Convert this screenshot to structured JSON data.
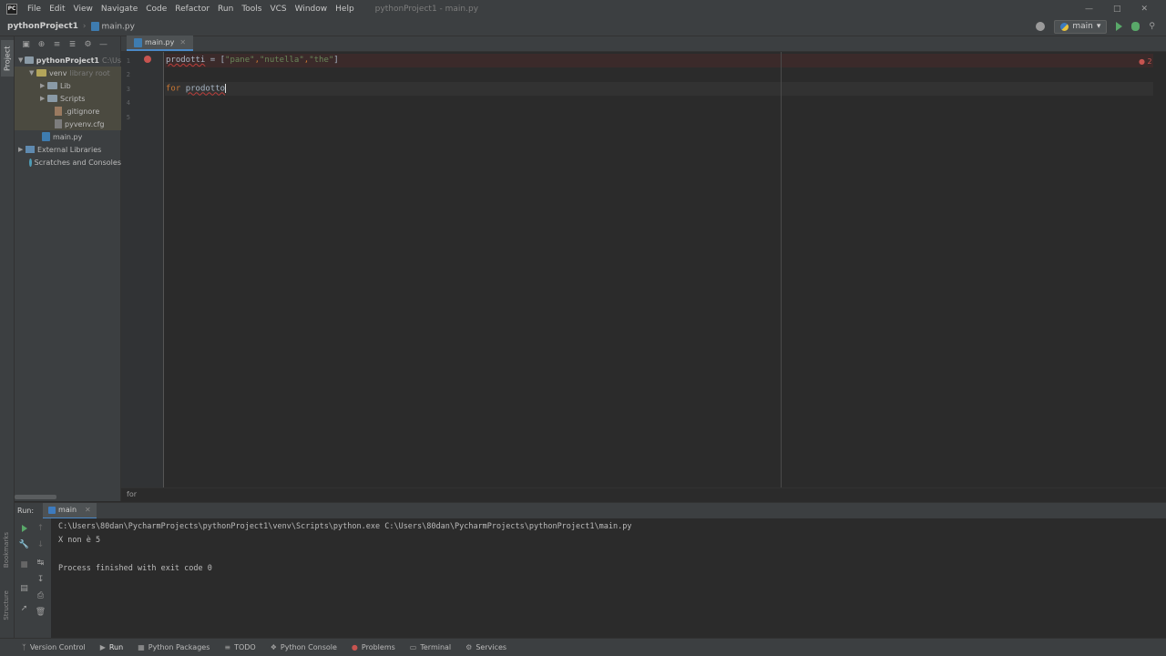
{
  "app": {
    "window_title": "pythonProject1 - main.py",
    "logo_text": "PC"
  },
  "menu": [
    "File",
    "Edit",
    "View",
    "Navigate",
    "Code",
    "Refactor",
    "Run",
    "Tools",
    "VCS",
    "Window",
    "Help"
  ],
  "nav": {
    "project": "pythonProject1",
    "file": "main.py",
    "run_config": "main"
  },
  "sidebar": {
    "tab_label": "Project",
    "structure_label": "Structure",
    "bookmarks_label": "Bookmarks",
    "tree": [
      {
        "label": "pythonProject1",
        "hint": "C:\\Us",
        "level": 0
      },
      {
        "label": "venv",
        "hint": "library root",
        "level": 1
      },
      {
        "label": "Lib",
        "hint": "",
        "level": 2
      },
      {
        "label": "Scripts",
        "hint": "",
        "level": 2
      },
      {
        "label": ".gitignore",
        "hint": "",
        "level": 2
      },
      {
        "label": "pyvenv.cfg",
        "hint": "",
        "level": 2
      },
      {
        "label": "main.py",
        "hint": "",
        "level": 1
      },
      {
        "label": "External Libraries",
        "hint": "",
        "level": 0
      },
      {
        "label": "Scratches and Consoles",
        "hint": "",
        "level": 0
      }
    ]
  },
  "editor": {
    "tab": "main.py",
    "line_numbers": [
      "1",
      "2",
      "3",
      "4",
      "5"
    ],
    "code": {
      "l1_var": "prodotti",
      "l1_eq": " = [",
      "l1_s1": "\"pane\"",
      "l1_c1": ",",
      "l1_s2": "\"nutella\"",
      "l1_c2": ",",
      "l1_s3": "\"the\"",
      "l1_end": "]",
      "l3_kw": "for ",
      "l3_var": "prodotto"
    },
    "error_count": "2",
    "breadcrumb": "for"
  },
  "run_panel": {
    "label": "Run:",
    "tab": "main",
    "console": [
      "C:\\Users\\80dan\\PycharmProjects\\pythonProject1\\venv\\Scripts\\python.exe C:\\Users\\80dan\\PycharmProjects\\pythonProject1\\main.py",
      "X non è 5",
      "",
      "Process finished with exit code 0"
    ]
  },
  "statusbar": {
    "items": [
      "Version Control",
      "Run",
      "Python Packages",
      "TODO",
      "Python Console",
      "Problems",
      "Terminal",
      "Services"
    ]
  },
  "colors": {
    "accent": "#4a88c7",
    "error": "#c75450",
    "run_green": "#59a869"
  }
}
